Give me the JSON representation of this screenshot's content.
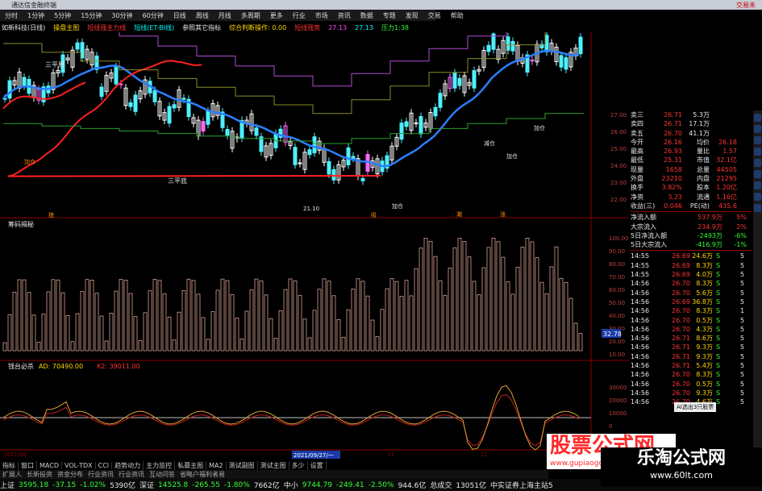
{
  "titlebar": {
    "title": "通达信金融终端",
    "right": "交易未"
  },
  "menubar": [
    "分时",
    "1分钟",
    "5分钟",
    "15分钟",
    "30分钟",
    "60分钟",
    "日线",
    "周线",
    "月线",
    "多周期",
    "更多",
    "行业",
    "市场",
    "资讯",
    "数据",
    "专题",
    "发现",
    "交易",
    "帮助"
  ],
  "indicator_bar": {
    "name": "如新科技(日线)",
    "b1": "操盘主图",
    "b2": "短线强主力线",
    "b3": "短线(ET-BI线)",
    "b4": "参照其它指标",
    "b5": "综合判断操作: 0.00",
    "b6": "短线强势",
    "v1": "27.13",
    "v2": "27.13",
    "b7": "压力1:38"
  },
  "main_chart": {
    "labels": {
      "t1": "三平原",
      "t2": "三平底",
      "t3": "加仓",
      "t4": "加仓",
      "t5": "加仓",
      "t6": "减仓",
      "t7": "加仓",
      "t8": "加仓",
      "price_low": "21.10",
      "h1": "狼",
      "h2": "吸",
      "h3": "潮",
      "h4": "涨"
    },
    "y_ticks": [
      "27.00",
      "26.00",
      "25.00",
      "24.00",
      "23.00",
      "22.00"
    ]
  },
  "sub1": {
    "title": "筹码揭秘",
    "y_ticks": [
      "100.00",
      "90.00",
      "80.00",
      "70.00",
      "60.00",
      "50.00",
      "40.00",
      "30.00",
      "20.00",
      "10.00"
    ],
    "current": "32.78"
  },
  "sub2": {
    "title": "钱台必杀",
    "ad": "AD: 70490.00",
    "k2": "K2: 39011.00",
    "y_ticks": [
      "30000",
      "20000",
      "10000",
      "0"
    ]
  },
  "date_axis": {
    "d1": "2021/08",
    "d2": "2021/09/27/一",
    "d3": "11",
    "d4": "12"
  },
  "quote": [
    {
      "a": "卖三",
      "b": "26.71",
      "c": "5.3万",
      "d": ""
    },
    {
      "a": "卖四",
      "b": "26.71",
      "c": "17.1万",
      "d": ""
    },
    {
      "a": "卖五",
      "b": "26.70",
      "c": "41.1万",
      "d": ""
    },
    {
      "a": "今开",
      "b": "26.16",
      "c": "均价",
      "d": "26.18"
    },
    {
      "a": "最高",
      "b": "26.93",
      "c": "量比",
      "d": "1.57"
    },
    {
      "a": "最低",
      "b": "25.31",
      "c": "市值",
      "d": "32.1亿"
    },
    {
      "a": "现量",
      "b": "1658",
      "c": "总量",
      "d": "44505"
    },
    {
      "a": "外盘",
      "b": "23210",
      "c": "内盘",
      "d": "21295"
    },
    {
      "a": "换手",
      "b": "3.82%",
      "c": "股本",
      "d": "1.20亿"
    },
    {
      "a": "净资",
      "b": "3.23",
      "c": "流通",
      "d": "1.16亿"
    },
    {
      "a": "收益(三)",
      "b": "0.046",
      "c": "PE(动)",
      "d": "435.6"
    }
  ],
  "flow": [
    {
      "a": "净流入额",
      "b": "537.9万",
      "c": "5%"
    },
    {
      "a": "大宗流入",
      "b": "234.9万",
      "c": "2%"
    },
    {
      "a": "5日净流入额",
      "b": "-2493万",
      "c": "-6%"
    },
    {
      "a": "5日大宗流入",
      "b": "-416.9万",
      "c": "-1%"
    }
  ],
  "ticks": [
    [
      "14:55",
      "26.69",
      "24.6万",
      "S",
      "5"
    ],
    [
      "14:55",
      "26.69",
      "8.3万",
      "S",
      "5"
    ],
    [
      "14:55",
      "26.69",
      "4.0万",
      "S",
      "5"
    ],
    [
      "14:56",
      "26.70",
      "8.3万",
      "S",
      "5"
    ],
    [
      "14:56",
      "26.70",
      "5.6万",
      "S",
      "5"
    ],
    [
      "14:56",
      "26.69",
      "36.8万",
      "S",
      "5"
    ],
    [
      "14:56",
      "26.70",
      "8.3万",
      "S",
      "1"
    ],
    [
      "14:56",
      "26.70",
      "0.5万",
      "S",
      "5"
    ],
    [
      "14:56",
      "26.70",
      "4.3万",
      "S",
      "5"
    ],
    [
      "14:56",
      "26.71",
      "8.6万",
      "S",
      "5"
    ],
    [
      "14:56",
      "26.71",
      "9.3万",
      "S",
      "5"
    ],
    [
      "14:56",
      "26.71",
      "9.3万",
      "S",
      "5"
    ],
    [
      "14:56",
      "26.71",
      "5.4万",
      "S",
      "5"
    ],
    [
      "14:56",
      "26.70",
      "8.3万",
      "S",
      "5"
    ],
    [
      "14:56",
      "26.70",
      "0.5万",
      "S",
      "5"
    ],
    [
      "14:56",
      "26.70",
      "9.3万",
      "S",
      "5"
    ],
    [
      "14:56",
      "26.70",
      "4.6万",
      "S",
      "5"
    ]
  ],
  "ai_tip": "AI选出3只股票 ",
  "bottom_tabs": [
    "指标",
    "窗口",
    "MACD",
    "VOL-TDX",
    "CCI",
    "趋势动力",
    "主力监控",
    "私募主图",
    "MA2",
    "测试副图",
    "测试主图",
    "多少",
    "设置"
  ],
  "bottom_tabs2": [
    "扩展人",
    "长新投资",
    "资金分布",
    "行业资讯",
    "行业资讯",
    "互动问答",
    "省略户福利者易"
  ],
  "status": [
    {
      "t": "上证",
      "c": "wh"
    },
    {
      "t": "3595.18",
      "c": "gr"
    },
    {
      "t": "-37.15",
      "c": "gr"
    },
    {
      "t": "-1.02%",
      "c": "gr"
    },
    {
      "t": "5390亿",
      "c": "wh"
    },
    {
      "t": "深证",
      "c": "wh"
    },
    {
      "t": "14525.8",
      "c": "gr"
    },
    {
      "t": "-265.55",
      "c": "gr"
    },
    {
      "t": "-1.80%",
      "c": "gr"
    },
    {
      "t": "7662亿",
      "c": "wh"
    },
    {
      "t": "中小",
      "c": "wh"
    },
    {
      "t": "9744.79",
      "c": "gr"
    },
    {
      "t": "-249.41",
      "c": "gr"
    },
    {
      "t": "-2.50%",
      "c": "gr"
    },
    {
      "t": "944.6亿",
      "c": "wh"
    },
    {
      "t": "总成交",
      "c": "wh"
    },
    {
      "t": "13051亿",
      "c": "wh"
    },
    {
      "t": "中实证券上海主站5",
      "c": "wh"
    }
  ],
  "watermark": {
    "w1": "股票公式网",
    "w1b": "www.gupiaogongshi.com",
    "w2": "乐淘公式网",
    "w2b": "www.60lt.com"
  }
}
